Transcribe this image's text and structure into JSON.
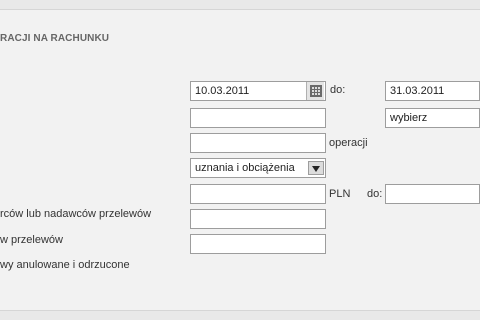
{
  "title": "RACJI NA RACHUNKU",
  "filters": {
    "date_from_value": "10.03.2011",
    "date_to_label": "do:",
    "date_to_value": "31.03.2011",
    "type_select_value": "wybierz",
    "operation_suffix": "operacji",
    "direction_select_value": "uznania i obciążenia",
    "amount_currency": "PLN",
    "amount_to_label": "do:"
  },
  "labels": {
    "recipients": "rców lub nadawców przelewów",
    "transfers": "w przelewów",
    "cancelled": "wy anulowane i odrzucone"
  },
  "icons": {
    "calendar": "calendar-icon",
    "dropdown": "chevron-down-icon"
  }
}
